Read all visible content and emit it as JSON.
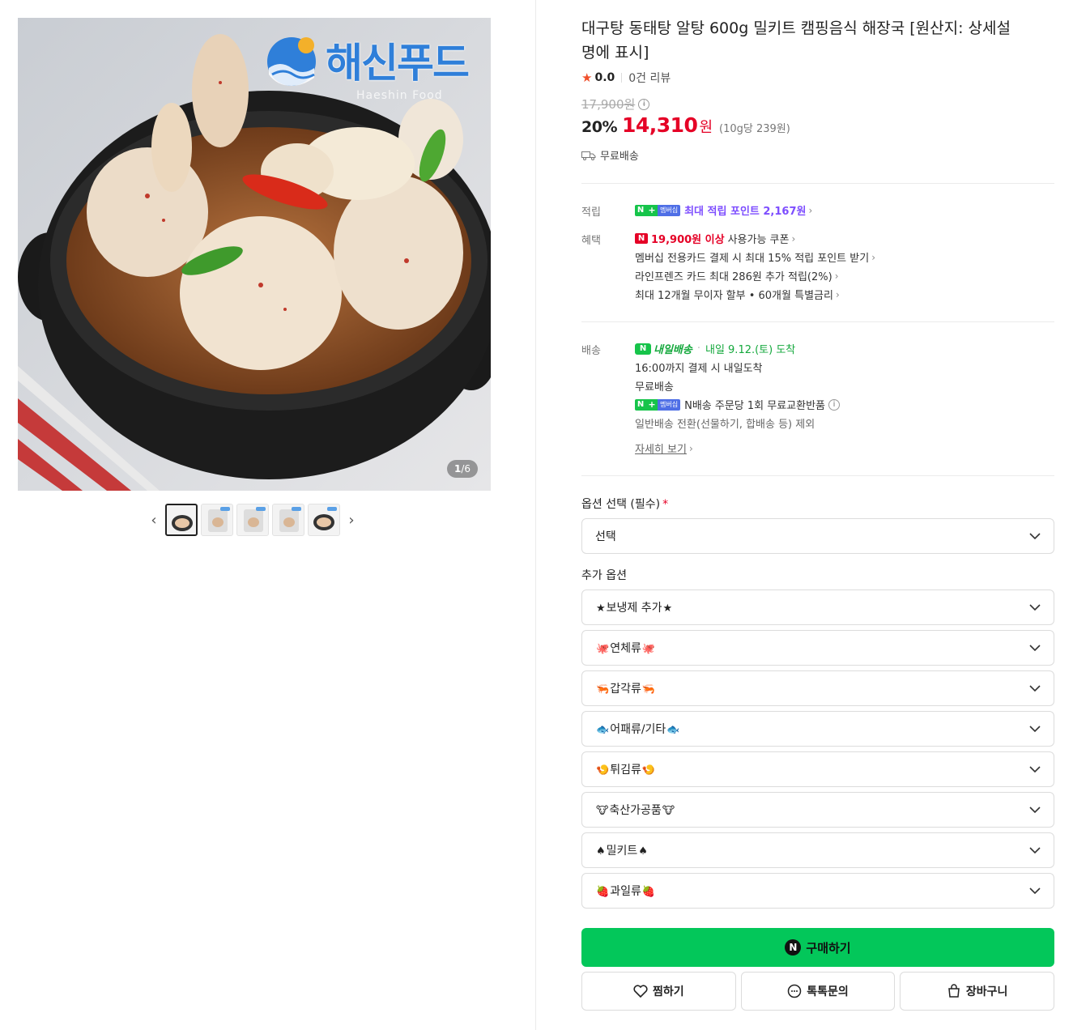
{
  "gallery": {
    "brand_logo_text": "해신푸드",
    "brand_logo_sub": "Haeshin Food",
    "counter_current": "1",
    "counter_total": "/6",
    "thumbnail_count": 5
  },
  "product": {
    "title": "대구탕 동태탕 알탕 600g 밀키트 캠핑음식 해장국 [원산지: 상세설명에 표시]",
    "rating_score": "0.0",
    "review_count": "0건 리뷰",
    "original_price": "17,900원",
    "discount": "20%",
    "price": "14,310",
    "price_unit": "원",
    "unit_price": "(10g당 239원)",
    "shipping_free": "무료배송"
  },
  "points": {
    "label": "적립",
    "badge_n": "N",
    "badge_plus": "+",
    "badge_membership": "멤버십",
    "text": "최대 적립 포인트 2,167원"
  },
  "benefits": {
    "label": "혜택",
    "coupon_badge": "N",
    "coupon_threshold": "19,900원 이상",
    "coupon_text": "사용가능 쿠폰",
    "items": [
      "멤버십 전용카드 결제 시 최대 15% 적립 포인트 받기",
      "라인프렌즈 카드 최대 286원 추가 적립(2%)",
      "최대 12개월 무이자 할부 • 60개월 특별금리"
    ]
  },
  "delivery": {
    "label": "배송",
    "tomorrow_icon": "N",
    "tomorrow_brand": "내일배송",
    "arrival": "내일 9.12.(토) 도착",
    "cutoff": "16:00까지 결제 시 내일도착",
    "fee": "무료배송",
    "exchange_text": "N배송 주문당 1회 무료교환반품",
    "exclusion": "일반배송 전환(선물하기, 합배송 등) 제외",
    "more_link": "자세히 보기"
  },
  "options": {
    "required_label": "옵션 선택 (필수)",
    "required_mark": "*",
    "required_select": "선택",
    "extra_label": "추가 옵션",
    "extra": [
      {
        "pre": "★",
        "label": "보냉제 추가",
        "post": "★"
      },
      {
        "pre": "🐙",
        "label": "연체류",
        "post": "🐙"
      },
      {
        "pre": "🦐",
        "label": "갑각류",
        "post": "🦐"
      },
      {
        "pre": "🐟",
        "label": "어패류/기타",
        "post": "🐟"
      },
      {
        "pre": "🍤",
        "label": "튀김류",
        "post": "🍤"
      },
      {
        "pre": "🐮",
        "label": "축산가공품",
        "post": "🐮"
      },
      {
        "pre": "♠",
        "label": "밀키트",
        "post": "♠"
      },
      {
        "pre": "🍓",
        "label": "과일류",
        "post": "🍓"
      }
    ]
  },
  "actions": {
    "buy_icon": "N",
    "buy": "구매하기",
    "wish": "찜하기",
    "talk": "톡톡문의",
    "cart": "장바구니"
  },
  "colors": {
    "price_red": "#e50026",
    "naver_green": "#03c75a",
    "point_purple": "#7d4dff"
  }
}
